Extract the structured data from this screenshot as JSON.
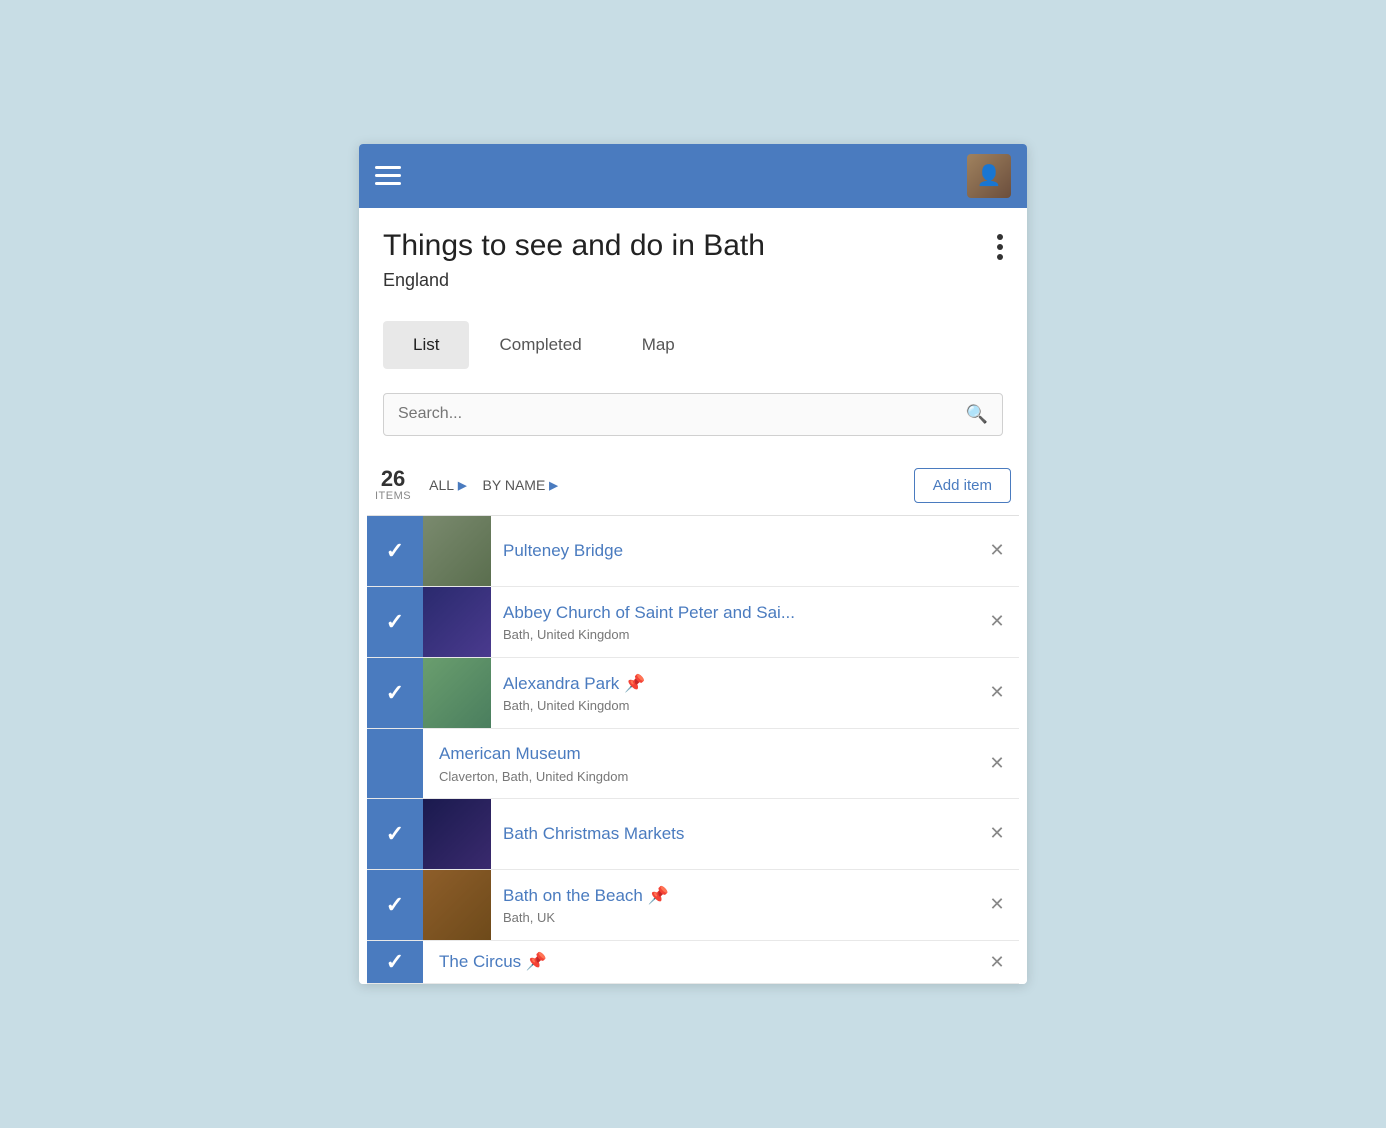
{
  "topBar": {
    "menuIcon": "menu-icon",
    "avatarIcon": "user-avatar"
  },
  "pageHeader": {
    "title": "Things to see and do in Bath",
    "subtitle": "England",
    "moreMenuIcon": "more-options-icon"
  },
  "tabs": [
    {
      "id": "list",
      "label": "List",
      "active": true
    },
    {
      "id": "completed",
      "label": "Completed",
      "active": false
    },
    {
      "id": "map",
      "label": "Map",
      "active": false
    }
  ],
  "search": {
    "placeholder": "Search..."
  },
  "listHeader": {
    "count": "26",
    "countLabel": "ITEMS",
    "filterAll": "ALL",
    "filterByName": "BY NAME",
    "addItemLabel": "Add item"
  },
  "listItems": [
    {
      "id": "pulteney-bridge",
      "name": "Pulteney Bridge",
      "location": "",
      "checked": true,
      "pinned": false,
      "hasThumb": true,
      "thumbClass": "thumb-bridge"
    },
    {
      "id": "abbey-church",
      "name": "Abbey Church of Saint Peter and Sai...",
      "location": "Bath, United Kingdom",
      "checked": true,
      "pinned": false,
      "hasThumb": true,
      "thumbClass": "thumb-abbey"
    },
    {
      "id": "alexandra-park",
      "name": "Alexandra Park 📌",
      "location": "Bath, United Kingdom",
      "checked": true,
      "pinned": true,
      "hasThumb": true,
      "thumbClass": "thumb-park"
    },
    {
      "id": "american-museum",
      "name": "American Museum",
      "location": "Claverton, Bath, United Kingdom",
      "checked": false,
      "pinned": false,
      "hasThumb": false,
      "thumbClass": ""
    },
    {
      "id": "bath-christmas-markets",
      "name": "Bath Christmas Markets",
      "location": "",
      "checked": true,
      "pinned": false,
      "hasThumb": true,
      "thumbClass": "thumb-christmas"
    },
    {
      "id": "bath-on-the-beach",
      "name": "Bath on the Beach 📌",
      "location": "Bath, UK",
      "checked": true,
      "pinned": true,
      "hasThumb": true,
      "thumbClass": "thumb-beach"
    }
  ]
}
